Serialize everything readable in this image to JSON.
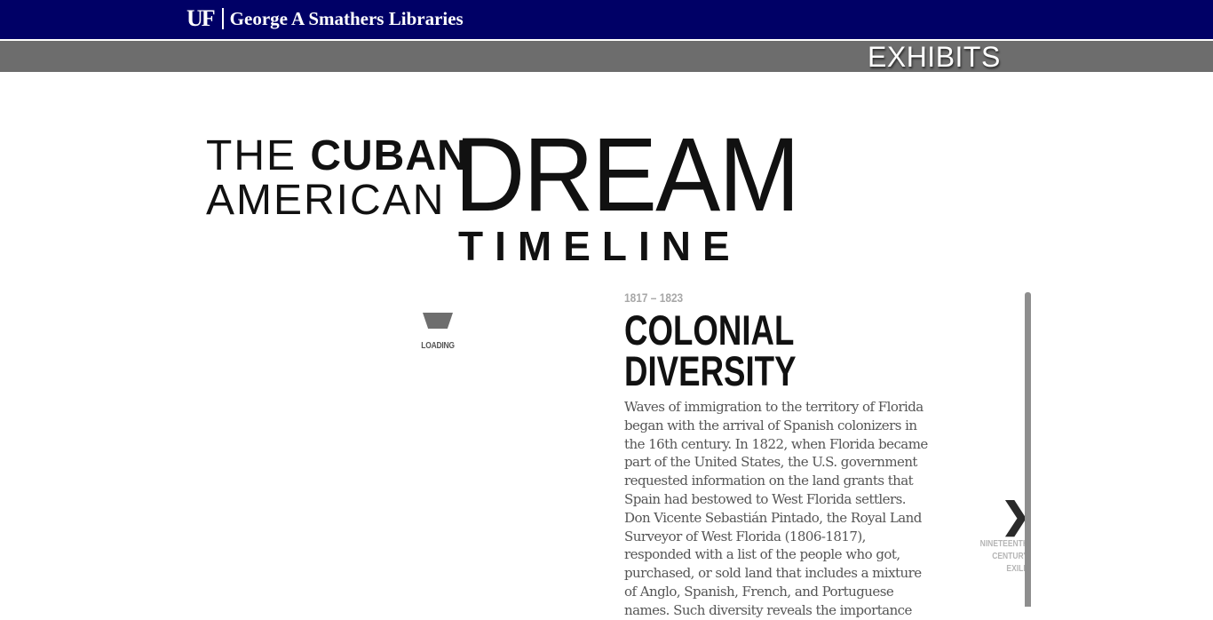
{
  "header": {
    "logo_text": "UF",
    "library_name": "George A Smathers Libraries",
    "section_label": "EXHIBITS"
  },
  "title": {
    "the": "THE",
    "cuban": "CUBAN",
    "american": "AMERICAN",
    "dream": "DREAM",
    "timeline": "TIMELINE"
  },
  "loader": {
    "label": "LOADING"
  },
  "entry": {
    "years": "1817 – 1823",
    "title_line1": "COLONIAL",
    "title_line2": "DIVERSITY",
    "body": "Waves of immigration to the territory of Florida began with the arrival of Spanish colonizers in the 16th century. In 1822, when Florida became part of the United States, the U.S. government requested information on the land grants that Spain had bestowed to West Florida settlers. Don Vicente Sebastián Pintado, the Royal Land Surveyor of West Florida (1806-1817), responded with a list of the people who got, purchased, or sold land that includes a mixture of Anglo, Spanish, French, and Portuguese names. Such diversity reveals the importance"
  },
  "navigation": {
    "next_icon": "chevron-right-icon",
    "next_label_line1": "NINETEENTH",
    "next_label_line2": "CENTURY EXILE"
  },
  "colors": {
    "header_bg": "#000066",
    "subheader_bg": "#6d6d6d",
    "text_dark": "#111111",
    "body_text": "#555555"
  }
}
